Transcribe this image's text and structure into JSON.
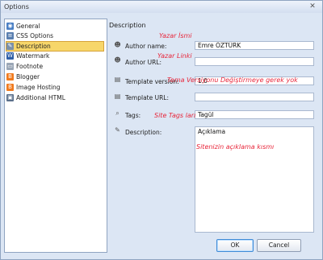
{
  "window": {
    "title": "Options",
    "close_label": "✕"
  },
  "nav": {
    "items": [
      {
        "label": "General",
        "icon": "general-icon",
        "color": "#4a7fc4"
      },
      {
        "label": "CSS Options",
        "icon": "css-icon",
        "color": "#5a7fb0"
      },
      {
        "label": "Description",
        "icon": "description-icon",
        "color": "#7a8fa8",
        "selected": true
      },
      {
        "label": "Watermark",
        "icon": "watermark-icon",
        "color": "#2f5fa8"
      },
      {
        "label": "Footnote",
        "icon": "footnote-icon",
        "color": "#9aa6b6"
      },
      {
        "label": "Blogger",
        "icon": "blogger-icon",
        "color": "#f07a1e"
      },
      {
        "label": "Image Hosting",
        "icon": "image-hosting-icon",
        "color": "#f07a1e"
      },
      {
        "label": "Additional HTML",
        "icon": "html-icon",
        "color": "#5a6f8a"
      }
    ]
  },
  "description": {
    "heading": "Description",
    "author_name_label": "Author name:",
    "author_name_value": "Emre ÖZTÜRK",
    "author_url_label": "Author URL:",
    "author_url_value": "",
    "template_version_label": "Template version:",
    "template_version_value": "1.0",
    "template_url_label": "Template URL:",
    "template_url_value": "",
    "tags_label": "Tags:",
    "tags_value": "Tagül",
    "description_label": "Description:",
    "description_value": "Açıklama"
  },
  "annotations": {
    "author_name": "Yazar İsmi",
    "author_url": "Yazar Linki",
    "template_version": "Tema Versiyonu Değiştirmeye gerek yok",
    "tags": "Site Tags ları",
    "description": "Sitenizin açıklama kısmı"
  },
  "buttons": {
    "ok": "OK",
    "cancel": "Cancel"
  },
  "colors": {
    "annotation": "#e8263a",
    "selection": "#f7d66a"
  }
}
